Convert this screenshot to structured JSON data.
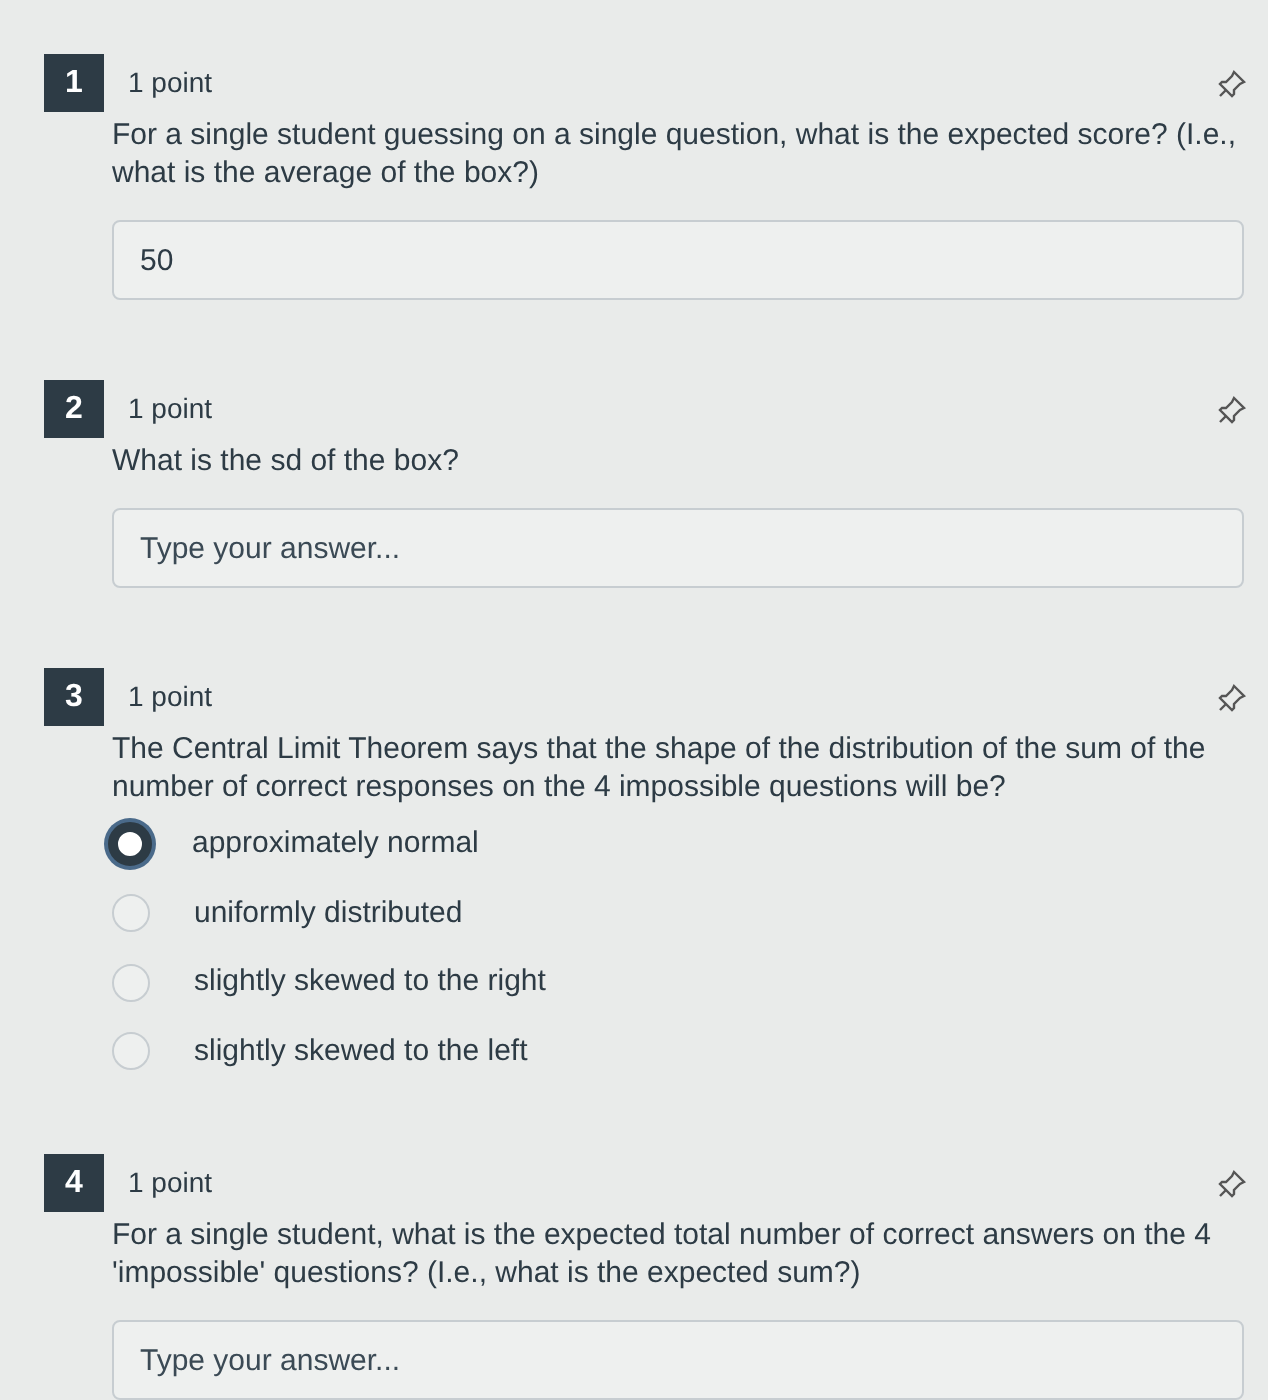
{
  "questions": [
    {
      "kind": "text",
      "number": "1",
      "points": "1 point",
      "prompt": "For a single student guessing on a single question, what is the expected score? (I.e., what is the average of the box?)",
      "value": "50"
    },
    {
      "kind": "text",
      "number": "2",
      "points": "1 point",
      "prompt": "What is the sd of the box?",
      "placeholder": "Type your answer..."
    },
    {
      "kind": "choice",
      "number": "3",
      "points": "1 point",
      "prompt": "The Central Limit Theorem says that the shape of the distribution of the sum of the number of correct responses on the 4 impossible questions will be?",
      "options": [
        {
          "label": "approximately normal",
          "selected": true
        },
        {
          "label": "uniformly distributed",
          "selected": false
        },
        {
          "label": "slightly skewed to the right",
          "selected": false
        },
        {
          "label": "slightly skewed to the left",
          "selected": false
        }
      ]
    },
    {
      "kind": "text",
      "number": "4",
      "points": "1 point",
      "prompt": "For a single student, what is the expected total number of correct answers on the 4 'impossible' questions? (I.e., what is the expected sum?)",
      "placeholder": "Type your answer..."
    }
  ]
}
